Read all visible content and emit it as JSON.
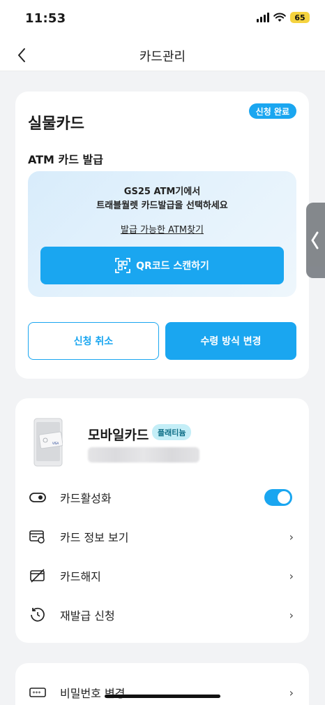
{
  "status_bar": {
    "time": "11:53",
    "battery": "65"
  },
  "nav": {
    "title": "카드관리"
  },
  "physical_card": {
    "title": "실물카드",
    "status_badge": "신청 완료",
    "section_title": "ATM 카드 발급",
    "atm_line1": "GS25 ATM기에서",
    "atm_line2": "트래블월렛 카드발급을 선택하세요",
    "atm_link": "발급 가능한 ATM찾기",
    "qr_button": "QR코드 스캔하기",
    "cancel_button": "신청 취소",
    "change_button": "수령 방식 변경"
  },
  "mobile_card": {
    "title": "모바일카드",
    "tier_badge": "플래티늄",
    "menu": [
      {
        "label": "카드활성화",
        "icon": "toggle-icon",
        "control": "switch",
        "on": true
      },
      {
        "label": "카드 정보 보기",
        "icon": "card-info-icon",
        "control": "chevron"
      },
      {
        "label": "카드해지",
        "icon": "card-cancel-icon",
        "control": "chevron"
      },
      {
        "label": "재발급 신청",
        "icon": "reissue-icon",
        "control": "chevron"
      }
    ]
  },
  "password_card": {
    "label": "비밀번호 변경"
  },
  "colors": {
    "accent": "#1aa6f0",
    "badge_bg": "#c4eef7",
    "page_bg": "#f2f3f5"
  }
}
